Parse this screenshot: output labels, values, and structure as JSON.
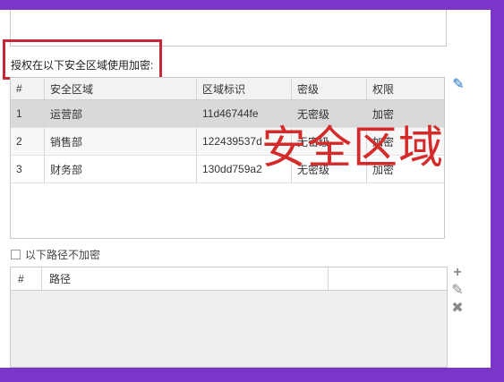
{
  "auth_label": "授权在以下安全区域使用加密:",
  "table1": {
    "headers": [
      "#",
      "安全区域",
      "区域标识",
      "密级",
      "权限"
    ],
    "rows": [
      [
        "1",
        "运营部",
        "11d46744fe",
        "无密级",
        "加密"
      ],
      [
        "2",
        "销售部",
        "122439537d",
        "无密级",
        "加密"
      ],
      [
        "3",
        "财务部",
        "130dd759a2",
        "无密级",
        "加密"
      ]
    ]
  },
  "overlay_text": "安全区域",
  "no_encrypt_label": "以下路径不加密",
  "table2": {
    "headers": [
      "#",
      "路径"
    ]
  },
  "icons": {
    "edit_top": "pencil-icon",
    "add": "plus-icon",
    "edit": "pencil-icon",
    "delete": "close-icon"
  },
  "colors": {
    "background": "#7b35c8",
    "highlight_box": "#c62838",
    "overlay_text": "#d42a2a",
    "edit_icon": "#1a6fc9"
  }
}
